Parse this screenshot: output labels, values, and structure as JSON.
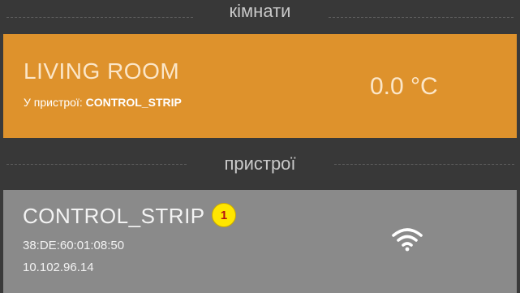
{
  "sections": {
    "rooms_title": "кімнати",
    "devices_title": "пристрої"
  },
  "room": {
    "name": "LIVING ROOM",
    "device_prefix": "У пристрої: ",
    "device_name": "CONTROL_STRIP",
    "temperature": "0.0 °C"
  },
  "device": {
    "name": "CONTROL_STRIP",
    "badge": "1",
    "mac": "38:DE:60:01:08:50",
    "ip": "10.102.96.14",
    "status_icon": "wifi-icon"
  },
  "colors": {
    "room_card": "#de922c",
    "device_card": "#8a8a8a",
    "background": "#3a3a3a",
    "badge": "#ffe600"
  }
}
